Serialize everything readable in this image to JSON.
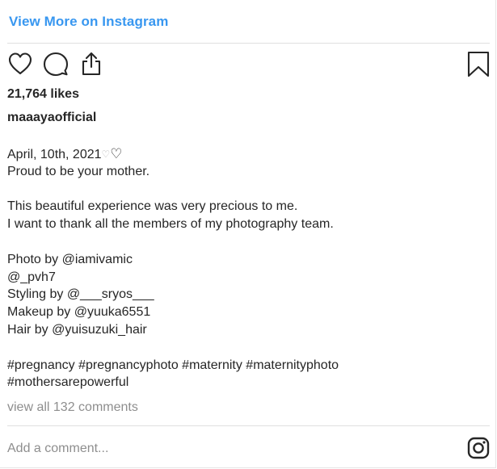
{
  "header": {
    "view_more_label": "View More on Instagram"
  },
  "actions": {
    "like_icon": "heart-outline-icon",
    "comment_icon": "comment-bubble-icon",
    "share_icon": "share-upload-icon",
    "save_icon": "bookmark-icon"
  },
  "post": {
    "likes": "21,764 likes",
    "username": "maaayaofficial",
    "caption": {
      "date": "April, 10th, 2021",
      "faint_glyph": "♡",
      "heart": "♡",
      "line1": "Proud to be your mother.",
      "line2": "This beautiful experience was very precious to me.",
      "line3": "I want to thank all the members of my photography team.",
      "credit1": "Photo by @iamivamic",
      "credit2": "@_pvh7",
      "credit3": "Styling by @___sryos___",
      "credit4": "Makeup by @yuuka6551",
      "credit5": "Hair by @yuisuzuki_hair",
      "hashtags1": "#pregnancy #pregnancyphoto #maternity #maternityphoto",
      "hashtags2": "#mothersarepowerful"
    },
    "view_comments": "view all 132 comments"
  },
  "footer": {
    "add_comment_placeholder": "Add a comment...",
    "logo_icon": "instagram-logo-icon"
  },
  "colors": {
    "link_blue": "#3897f0",
    "text": "#262626",
    "muted": "#8e8e8e",
    "divider": "#e0e0e0"
  }
}
